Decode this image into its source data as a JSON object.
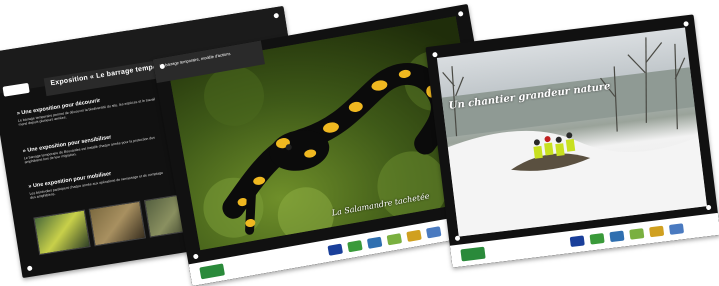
{
  "panel_left": {
    "title": "Exposition « Le barrage temporaire de Bouvardes »",
    "sections": [
      {
        "heading": "» Une exposition pour découvrir",
        "text": "Le barrage temporaire permet de découvrir la biodiversité du site, les espèces et le travail mené depuis plusieurs années."
      },
      {
        "heading": "» Une exposition pour sensibiliser",
        "text": "Le barrage temporaire de Bouvardes est installé chaque année pour la protection des amphibiens lors de leur migration."
      },
      {
        "heading": "» Une exposition pour mobiliser",
        "text": "Les bénévoles participent chaque année aux opérations de ramassage et de comptage des amphibiens."
      }
    ]
  },
  "panel_center": {
    "side_text": "Le barrage temporaire, modèle d'actions",
    "caption": "La Salamandre tachetée"
  },
  "panel_right": {
    "title": "Un chantier grandeur nature"
  }
}
